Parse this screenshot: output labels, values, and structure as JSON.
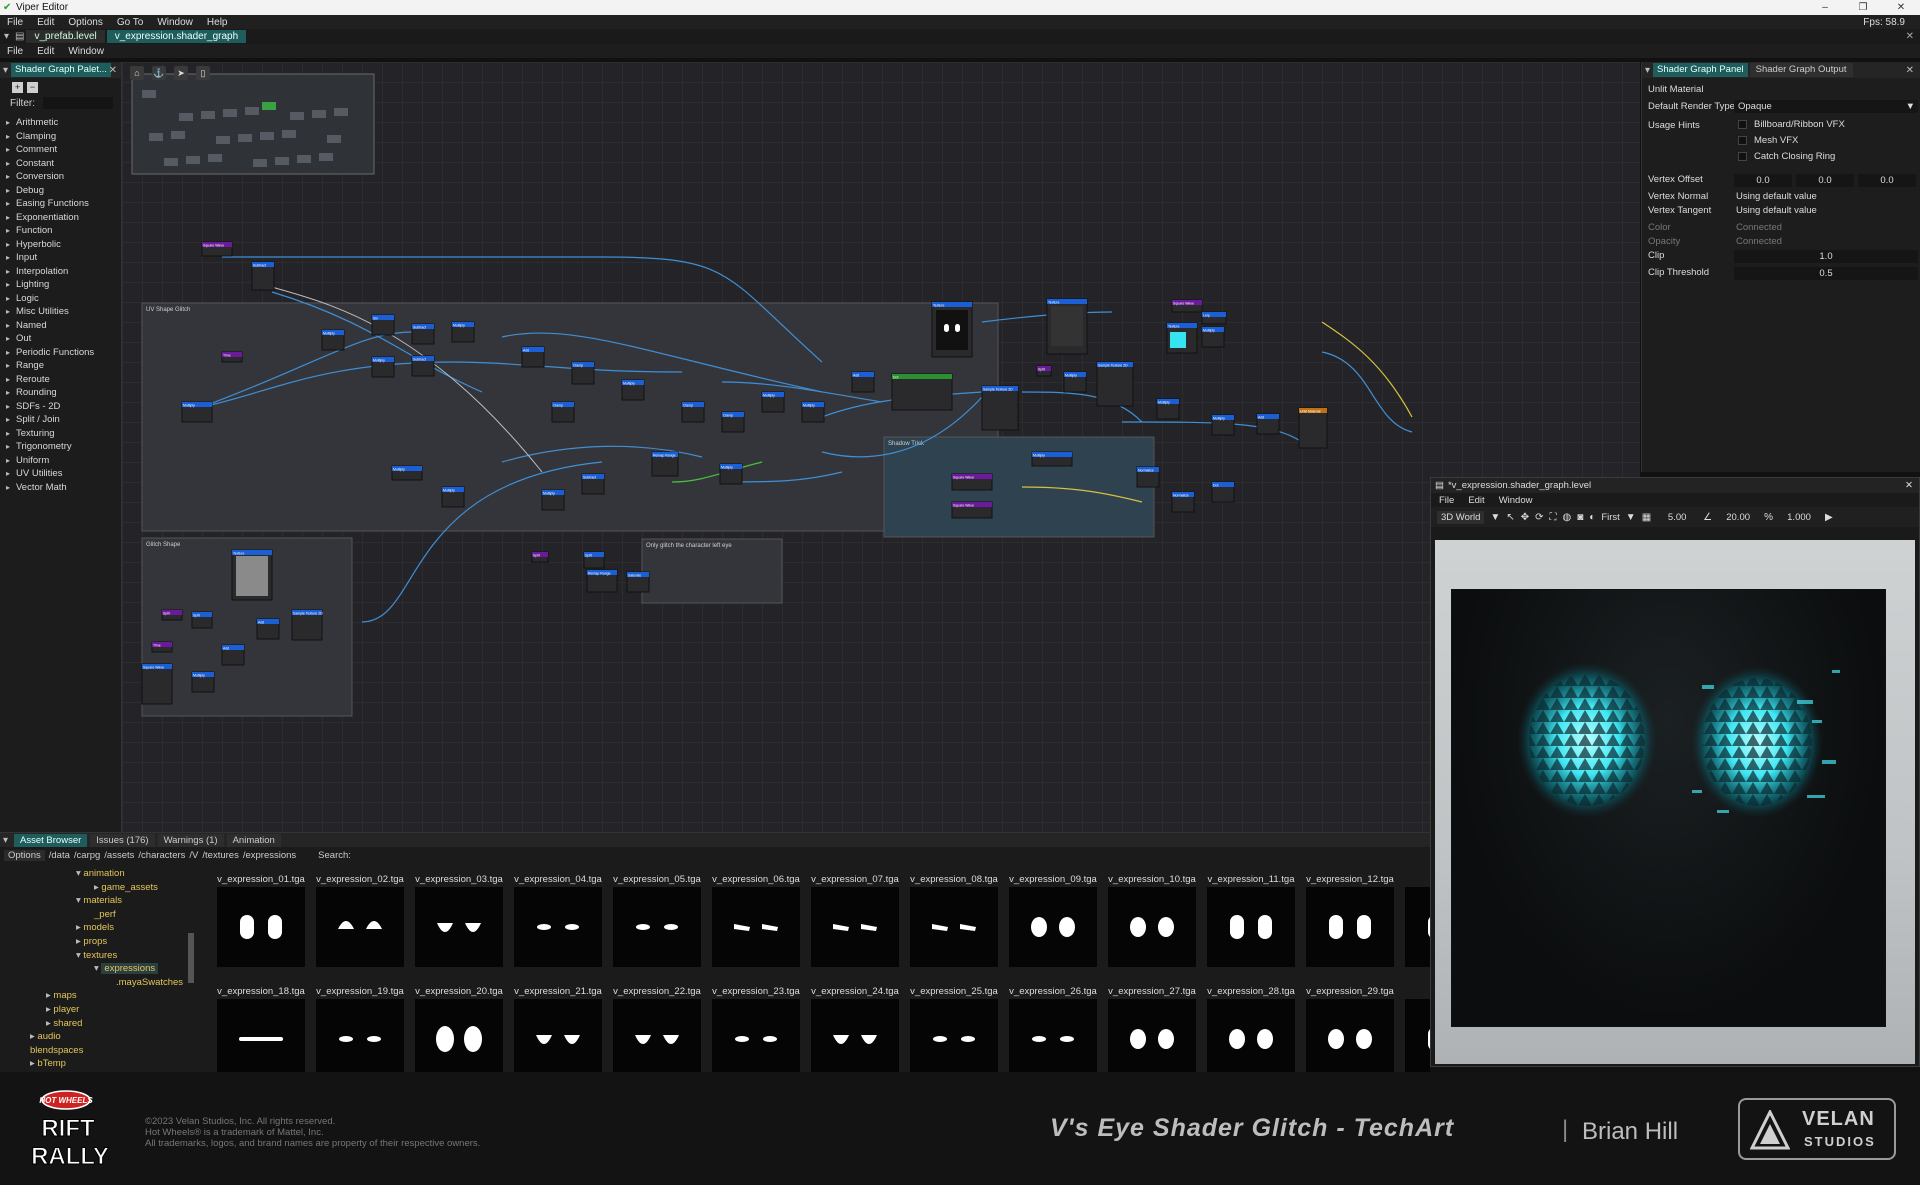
{
  "window": {
    "title": "Viper Editor",
    "fps": "Fps: 58.9",
    "buttons": [
      "–",
      "❐",
      "✕"
    ]
  },
  "menu": [
    "File",
    "Edit",
    "Options",
    "Go To",
    "Window",
    "Help"
  ],
  "doc_tabs": [
    "v_prefab.level",
    "v_expression.shader_graph"
  ],
  "submenu": [
    "File",
    "Edit",
    "Window"
  ],
  "palette": {
    "tab": "Shader Graph Palet...",
    "filter_label": "Filter:",
    "categories": [
      "Arithmetic",
      "Clamping",
      "Comment",
      "Constant",
      "Conversion",
      "Debug",
      "Easing Functions",
      "Exponentiation",
      "Function",
      "Hyperbolic",
      "Input",
      "Interpolation",
      "Lighting",
      "Logic",
      "Misc Utilities",
      "Named",
      "Out",
      "Periodic Functions",
      "Range",
      "Reroute",
      "Rounding",
      "SDFs - 2D",
      "Split / Join",
      "Texturing",
      "Trigonometry",
      "Uniform",
      "UV Utilities",
      "Vector Math"
    ]
  },
  "graph": {
    "groups": [
      "UV Shape Glitch",
      "Glitch Shape",
      "Only glitch the character left eye",
      "Shadow Trick"
    ],
    "node_labels": [
      "Multiply",
      "Sin",
      "Subtract",
      "Add",
      "Clamp",
      "Remap Range",
      "Saturate",
      "Sample Texture 2D",
      "Time",
      "Split",
      "Square Wave",
      "Texture",
      "Unlit Material",
      "Normalize",
      "Dot",
      "Lerp"
    ]
  },
  "right_panel": {
    "tabs": [
      "Shader Graph Panel",
      "Shader Graph Output"
    ],
    "material": "Unlit Material",
    "render_type_label": "Default Render Type",
    "render_type": "Opaque",
    "usage_label": "Usage Hints",
    "usage_hints": [
      "Billboard/Ribbon VFX",
      "Mesh VFX",
      "Catch Closing Ring"
    ],
    "vertex_offset_label": "Vertex Offset",
    "vertex_offset": [
      "0.0",
      "0.0",
      "0.0"
    ],
    "vertex_normal_label": "Vertex Normal",
    "vertex_normal": "Using default value",
    "vertex_tangent_label": "Vertex Tangent",
    "vertex_tangent": "Using default value",
    "color_label": "Color",
    "color_val": "Connected",
    "opacity_label": "Opacity",
    "opacity_val": "Connected",
    "clip_label": "Clip",
    "clip": "1.0",
    "clip_threshold_label": "Clip Threshold",
    "clip_threshold": "0.5"
  },
  "viewport": {
    "title": "*v_expression.shader_graph.level",
    "menu": [
      "File",
      "Edit",
      "Window"
    ],
    "toolbar": {
      "world": "3D World",
      "camera": "First",
      "v1": "5.00",
      "v2": "20.00",
      "v3": "1.000"
    }
  },
  "asset_browser": {
    "tabs": [
      "Asset Browser",
      "Issues (176)",
      "Warnings (1)",
      "Animation"
    ],
    "options": "Options",
    "path": [
      "/data",
      "/carpg",
      "/assets",
      "/characters",
      "/V",
      "/textures",
      "/expressions"
    ],
    "search_label": "Search:",
    "tree": [
      {
        "label": "animation",
        "indent": 1,
        "arrow": "▾"
      },
      {
        "label": "game_assets",
        "indent": 2,
        "arrow": "▸"
      },
      {
        "label": "materials",
        "indent": 1,
        "arrow": "▾"
      },
      {
        "label": "_perf",
        "indent": 2,
        "arrow": ""
      },
      {
        "label": "models",
        "indent": 1,
        "arrow": "▸"
      },
      {
        "label": "props",
        "indent": 1,
        "arrow": "▸"
      },
      {
        "label": "textures",
        "indent": 1,
        "arrow": "▾"
      },
      {
        "label": "expressions",
        "indent": 2,
        "arrow": "▾"
      },
      {
        "label": ".mayaSwatches",
        "indent": 3,
        "arrow": ""
      },
      {
        "label": "maps",
        "indent": 0,
        "arrow": "▸"
      },
      {
        "label": "player",
        "indent": 0,
        "arrow": "▸"
      },
      {
        "label": "shared",
        "indent": 0,
        "arrow": "▸"
      },
      {
        "label": "audio",
        "indent": -1,
        "arrow": "▸"
      },
      {
        "label": "blendspaces",
        "indent": -1,
        "arrow": ""
      },
      {
        "label": "bTemp",
        "indent": -1,
        "arrow": "▸"
      }
    ],
    "row1": [
      "v_expression_01.tga",
      "v_expression_02.tga",
      "v_expression_03.tga",
      "v_expression_04.tga",
      "v_expression_05.tga",
      "v_expression_06.tga",
      "v_expression_07.tga",
      "v_expression_08.tga",
      "v_expression_09.tga",
      "v_expression_10.tga",
      "v_expression_11.tga",
      "v_expression_12.tga",
      "v_ex"
    ],
    "row2": [
      "v_expression_18.tga",
      "v_expression_19.tga",
      "v_expression_20.tga",
      "v_expression_21.tga",
      "v_expression_22.tga",
      "v_expression_23.tga",
      "v_expression_24.tga",
      "v_expression_25.tga",
      "v_expression_26.tga",
      "v_expression_27.tga",
      "v_expression_28.tga",
      "v_expression_29.tga",
      "v_ex"
    ]
  },
  "footer": {
    "legal": [
      "©2023 Velan Studios, Inc. All rights reserved.",
      "Hot Wheels® is a trademark of Mattel, Inc.",
      "All trademarks, logos, and brand names are property of their respective owners."
    ],
    "title": "V's Eye Shader Glitch - TechArt",
    "sep": "|",
    "author": "Brian Hill",
    "logo_line1": "VELAN",
    "logo_line2": "STUDIOS",
    "game_logo": "RIFT RALLY"
  }
}
